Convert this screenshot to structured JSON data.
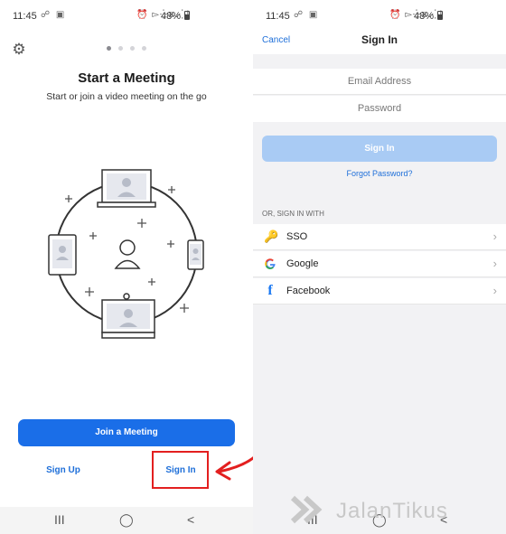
{
  "left": {
    "status": {
      "time": "11:45",
      "battery": "48%"
    },
    "title": "Start a Meeting",
    "subtitle": "Start or join a video meeting on the go",
    "join_label": "Join a Meeting",
    "signup_label": "Sign Up",
    "signin_label": "Sign In",
    "nav": {
      "recents": "III",
      "home": "◯",
      "back": "<"
    }
  },
  "right": {
    "status": {
      "time": "11:45",
      "battery": "48%"
    },
    "cancel_label": "Cancel",
    "title": "Sign In",
    "email_placeholder": "Email Address",
    "password_placeholder": "Password",
    "signin_label": "Sign In",
    "forgot_label": "Forgot Password?",
    "or_label": "OR, SIGN IN WITH",
    "options": [
      {
        "label": "SSO",
        "icon": "key-icon"
      },
      {
        "label": "Google",
        "icon": "google-icon"
      },
      {
        "label": "Facebook",
        "icon": "facebook-icon"
      }
    ]
  },
  "watermark": "JalanTikus",
  "colors": {
    "primary": "#1a6ee8",
    "primary_disabled": "#a9cbf4",
    "link": "#1e6fd9",
    "highlight": "#e31f1f"
  }
}
